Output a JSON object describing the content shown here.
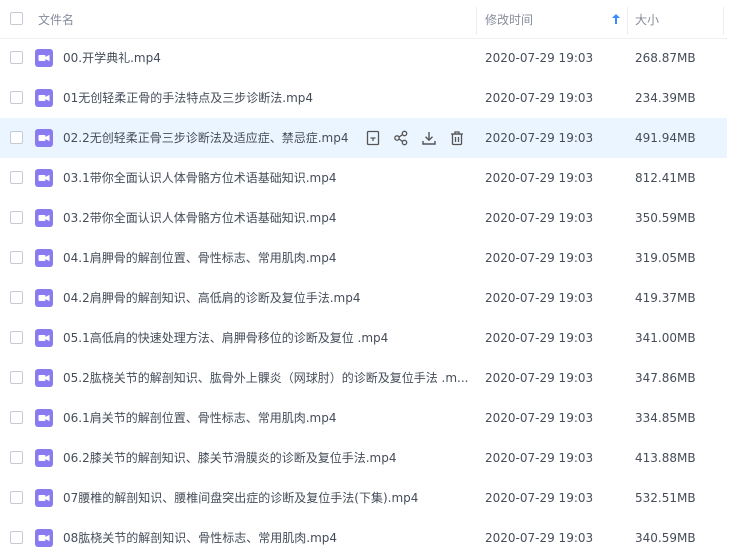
{
  "header": {
    "name_label": "文件名",
    "modified_label": "修改时间",
    "size_label": "大小"
  },
  "colors": {
    "icon": "#8a7bf0",
    "highlight": "#ebf5ff",
    "text": "#454d5a",
    "header_text": "#878c9c"
  },
  "row_actions": [
    "rename-icon",
    "share-icon",
    "download-icon",
    "delete-icon"
  ],
  "files": [
    {
      "name": "00.开学典礼.mp4",
      "modified": "2020-07-29 19:03",
      "size": "268.87MB"
    },
    {
      "name": "01无创轻柔正骨的手法特点及三步诊断法.mp4",
      "modified": "2020-07-29 19:03",
      "size": "234.39MB"
    },
    {
      "name": "02.2无创轻柔正骨三步诊断法及适应症、禁忌症.mp4",
      "modified": "2020-07-29 19:03",
      "size": "491.94MB"
    },
    {
      "name": "03.1带你全面认识人体骨骼方位术语基础知识.mp4",
      "modified": "2020-07-29 19:03",
      "size": "812.41MB"
    },
    {
      "name": "03.2带你全面认识人体骨骼方位术语基础知识.mp4",
      "modified": "2020-07-29 19:03",
      "size": "350.59MB"
    },
    {
      "name": "04.1肩胛骨的解剖位置、骨性标志、常用肌肉.mp4",
      "modified": "2020-07-29 19:03",
      "size": "319.05MB"
    },
    {
      "name": "04.2肩胛骨的解剖知识、高低肩的诊断及复位手法.mp4",
      "modified": "2020-07-29 19:03",
      "size": "419.37MB"
    },
    {
      "name": "05.1高低肩的快速处理方法、肩胛骨移位的诊断及复位 .mp4",
      "modified": "2020-07-29 19:03",
      "size": "341.00MB"
    },
    {
      "name": "05.2肱桡关节的解剖知识、肱骨外上髁炎（网球肘）的诊断及复位手法 .m...",
      "modified": "2020-07-29 19:03",
      "size": "347.86MB"
    },
    {
      "name": "06.1肩关节的解剖位置、骨性标志、常用肌肉.mp4",
      "modified": "2020-07-29 19:03",
      "size": "334.85MB"
    },
    {
      "name": "06.2膝关节的解剖知识、膝关节滑膜炎的诊断及复位手法.mp4",
      "modified": "2020-07-29 19:03",
      "size": "413.88MB"
    },
    {
      "name": "07腰椎的解剖知识、腰椎间盘突出症的诊断及复位手法(下集).mp4",
      "modified": "2020-07-29 19:03",
      "size": "532.51MB"
    },
    {
      "name": "08肱桡关节的解剖知识、骨性标志、常用肌肉.mp4",
      "modified": "2020-07-29 19:03",
      "size": "340.59MB"
    }
  ]
}
